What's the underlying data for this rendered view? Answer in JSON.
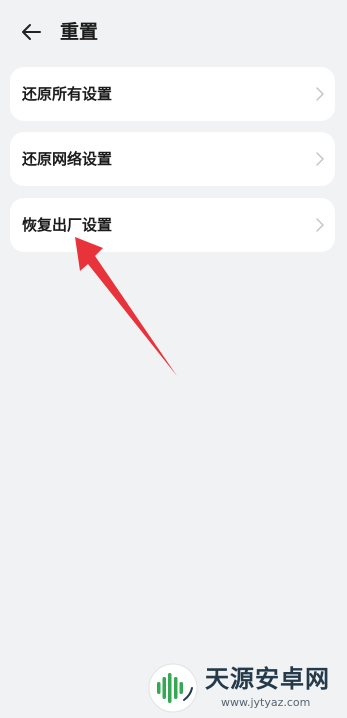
{
  "header": {
    "title": "重置",
    "back_icon": "arrow-left-icon"
  },
  "settings": {
    "items": [
      {
        "label": "还原所有设置",
        "icon": "chevron-right-icon"
      },
      {
        "label": "还原网络设置",
        "icon": "chevron-right-icon"
      },
      {
        "label": "恢复出厂设置",
        "icon": "chevron-right-icon"
      }
    ]
  },
  "annotation": {
    "color": "#e8333b",
    "icon": "red-arrow-pointer"
  },
  "watermark": {
    "brand": "天源安卓网",
    "url": "www.jytyaz.com"
  }
}
